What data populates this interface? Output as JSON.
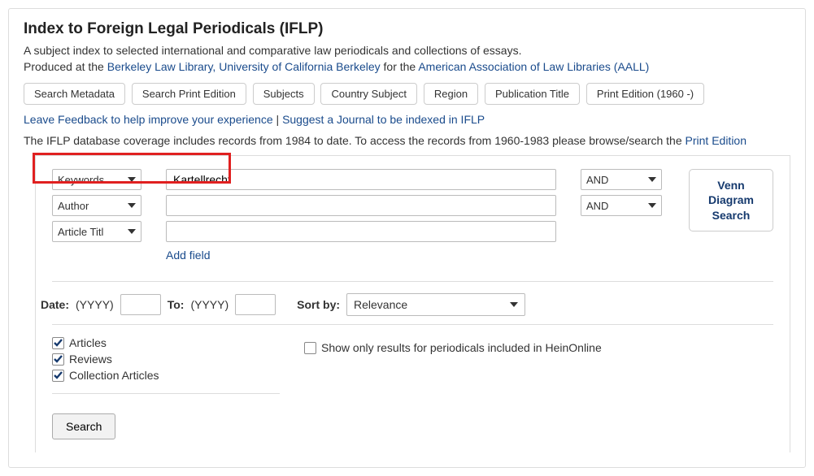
{
  "title": "Index to Foreign Legal Periodicals (IFLP)",
  "desc_line1": "A subject index to selected international and comparative law periodicals and collections of essays.",
  "desc_prefix": "Produced at the ",
  "desc_link1": "Berkeley Law Library, University of California Berkeley",
  "desc_mid": " for the ",
  "desc_link2": "American Association of Law Libraries (AALL)",
  "tabs": {
    "t0": "Search Metadata",
    "t1": "Search Print Edition",
    "t2": "Subjects",
    "t3": "Country Subject",
    "t4": "Region",
    "t5": "Publication Title",
    "t6": "Print Edition (1960 -)"
  },
  "feedback": {
    "leave": "Leave Feedback to help improve your experience",
    "sep": " | ",
    "suggest": "Suggest a Journal to be indexed in IFLP"
  },
  "coverage": {
    "pre": "The IFLP database coverage includes records from 1984 to date. To access the records from 1960-1983 please browse/search the ",
    "link": "Print Edition"
  },
  "search": {
    "rows": {
      "r0": {
        "field": "Keywords",
        "value": "Kartellrecht",
        "op": "AND"
      },
      "r1": {
        "field": "Author",
        "value": "",
        "op": "AND"
      },
      "r2": {
        "field": "Article Titl",
        "value": "",
        "op": ""
      }
    },
    "add_field": "Add field",
    "venn": "Venn Diagram Search"
  },
  "filters": {
    "date_label": "Date:",
    "yyyy": "(YYYY)",
    "to_label": "To:",
    "sort_label": "Sort by:",
    "sort_value": "Relevance"
  },
  "checks": {
    "articles": "Articles",
    "reviews": "Reviews",
    "collection": "Collection Articles",
    "heinonly": "Show only results for periodicals included in HeinOnline"
  },
  "search_btn": "Search"
}
